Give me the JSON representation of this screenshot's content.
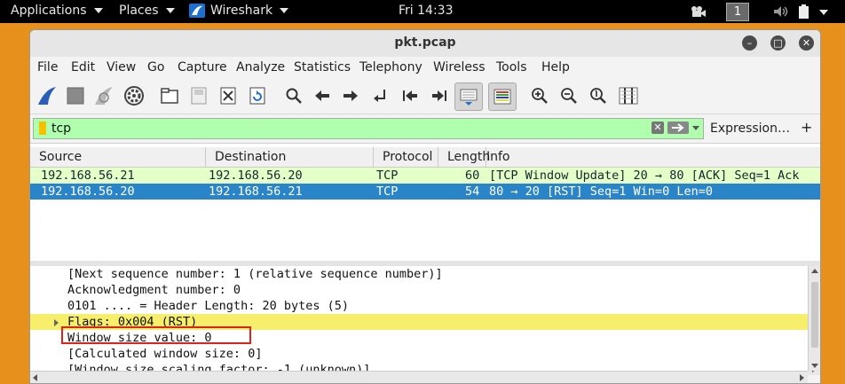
{
  "topbar": {
    "applications": "Applications",
    "places": "Places",
    "app_name": "Wireshark",
    "clock": "Fri 14:33",
    "workspace": "1"
  },
  "window": {
    "title": "pkt.pcap"
  },
  "menu": [
    "File",
    "Edit",
    "View",
    "Go",
    "Capture",
    "Analyze",
    "Statistics",
    "Telephony",
    "Wireless",
    "Tools",
    "Help"
  ],
  "toolbar": {
    "icons": [
      "shark-fin-start-icon",
      "stop-square-icon",
      "shark-fin-restart-icon",
      "gear-options-icon",
      "open-folder-icon",
      "save-file-icon",
      "close-file-icon",
      "reload-icon",
      "search-icon",
      "go-back-icon",
      "go-forward-icon",
      "go-to-packet-icon",
      "first-packet-icon",
      "last-packet-icon",
      "autoscroll-icon",
      "colorize-icon",
      "zoom-in-icon",
      "zoom-out-icon",
      "zoom-normal-icon",
      "resize-columns-icon"
    ]
  },
  "filter": {
    "value": "tcp",
    "expression_label": "Expression…",
    "plus_label": "+"
  },
  "packet_list": {
    "columns": [
      "Source",
      "Destination",
      "Protocol",
      "Length",
      "Info"
    ],
    "rows": [
      {
        "source": "192.168.56.21",
        "destination": "192.168.56.20",
        "protocol": "TCP",
        "length": "60",
        "info": "[TCP Window Update] 20 → 80 [ACK] Seq=1 Ack"
      },
      {
        "source": "192.168.56.20",
        "destination": "192.168.56.21",
        "protocol": "TCP",
        "length": "54",
        "info": "80 → 20 [RST] Seq=1 Win=0 Len=0"
      }
    ]
  },
  "details": {
    "lines": [
      "[Next sequence number: 1    (relative sequence number)]",
      "Acknowledgment number: 0",
      "0101 .... = Header Length: 20 bytes (5)",
      "Flags: 0x004 (RST)",
      "Window size value: 0",
      "[Calculated window size: 0]",
      "[Window size scaling factor: -1 (unknown)]"
    ]
  },
  "colors": {
    "desktop": "#e8901c",
    "selected_row": "#2a84c8",
    "tcp_row": "#e4ffc7",
    "filter_ok": "#afffaf",
    "flags_highlight": "#f7ef6b",
    "annotation": "#e0221c"
  }
}
